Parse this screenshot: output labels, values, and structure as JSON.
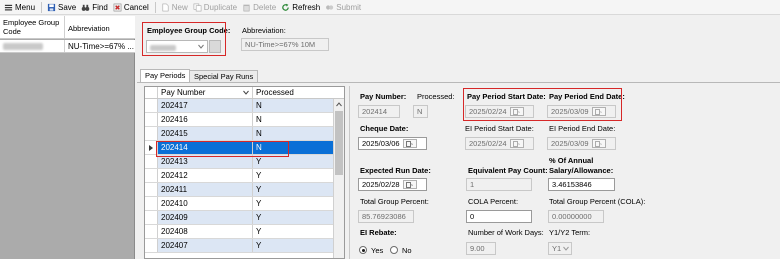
{
  "toolbar": {
    "menu": "Menu",
    "save": "Save",
    "find": "Find",
    "cancel": "Cancel",
    "new": "New",
    "duplicate": "Duplicate",
    "delete": "Delete",
    "refresh": "Refresh",
    "submit": "Submit"
  },
  "left_grid": {
    "col_code": "Employee Group Code",
    "col_abbreviation": "Abbreviation",
    "row_abbreviation": "NU-Time>=67% ..."
  },
  "header_form": {
    "group_code_label": "Employee Group Code:",
    "abbreviation_label": "Abbreviation:",
    "abbreviation_value": "NU-Time>=67% 10M"
  },
  "tabs": [
    "Pay Periods",
    "Special Pay Runs"
  ],
  "pay_periods": {
    "col_pay_number": "Pay Number",
    "col_processed": "Processed",
    "rows": [
      {
        "pay_number": "202417",
        "processed": "N"
      },
      {
        "pay_number": "202416",
        "processed": "N"
      },
      {
        "pay_number": "202415",
        "processed": "N"
      },
      {
        "pay_number": "202414",
        "processed": "N"
      },
      {
        "pay_number": "202413",
        "processed": "Y"
      },
      {
        "pay_number": "202412",
        "processed": "Y"
      },
      {
        "pay_number": "202411",
        "processed": "Y"
      },
      {
        "pay_number": "202410",
        "processed": "Y"
      },
      {
        "pay_number": "202409",
        "processed": "Y"
      },
      {
        "pay_number": "202408",
        "processed": "Y"
      },
      {
        "pay_number": "202407",
        "processed": "Y"
      }
    ]
  },
  "detail": {
    "pay_number_label": "Pay Number:",
    "pay_number_value": "202414",
    "processed_label": "Processed:",
    "processed_value": "N",
    "pay_period_start_label": "Pay Period Start Date:",
    "pay_period_start_value": "2025/02/24",
    "pay_period_end_label": "Pay Period End Date:",
    "pay_period_end_value": "2025/03/09",
    "cheque_date_label": "Cheque Date:",
    "cheque_date_value": "2025/03/06",
    "ei_start_label": "EI Period Start Date:",
    "ei_start_value": "2025/02/24",
    "ei_end_label": "EI Period End Date:",
    "ei_end_value": "2025/03/09",
    "expected_run_label": "Expected Run Date:",
    "expected_run_value": "2025/02/28",
    "equiv_pay_count_label": "Equivalent Pay Count:",
    "equiv_pay_count_value": "1",
    "pct_annual_label_1": "% Of Annual",
    "pct_annual_label_2": "Salary/Allowance:",
    "pct_annual_value": "3.46153846",
    "total_group_pct_label": "Total Group Percent:",
    "total_group_pct_value": "85.76923086",
    "cola_pct_label": "COLA Percent:",
    "cola_pct_value": "0",
    "total_group_cola_label": "Total Group Percent (COLA):",
    "total_group_cola_value": "0.00000000",
    "ei_rebate_label": "EI Rebate:",
    "ei_rebate_yes": "Yes",
    "ei_rebate_no": "No",
    "work_days_label": "Number of Work Days:",
    "work_days_value": "9.00",
    "y1y2_label": "Y1/Y2 Term:",
    "y1y2_value": "Y1"
  },
  "colors": {
    "selected_row": "#0a6fd6",
    "alt_row": "#dce6f4",
    "highlight_box": "#d62828"
  }
}
